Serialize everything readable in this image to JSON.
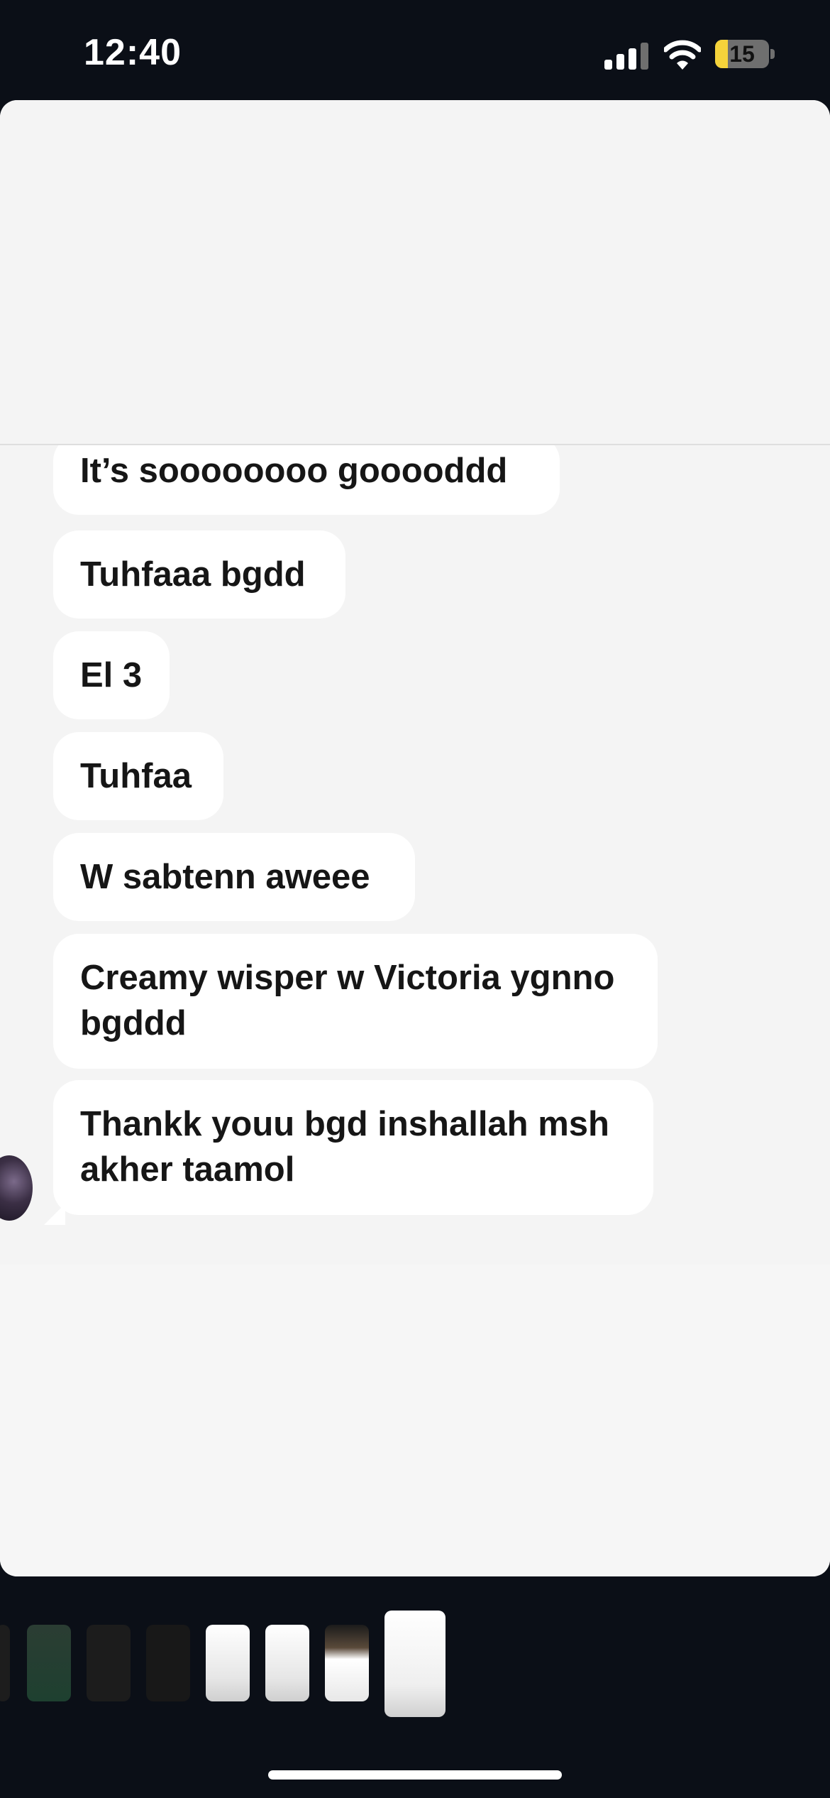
{
  "status_bar": {
    "time": "12:40",
    "battery_level": "15",
    "battery_color": "#f5d33b",
    "signal_bars_active": 3,
    "signal_bars_total": 4,
    "icons": [
      "cellular-signal-icon",
      "wifi-icon",
      "battery-icon"
    ]
  },
  "chat": {
    "messages": [
      {
        "text": "It’s soooooooo gooooddd"
      },
      {
        "text": "Tuhfaaa bgdd"
      },
      {
        "text": "El 3"
      },
      {
        "text": "Tuhfaa"
      },
      {
        "text": "W sabtenn aweee"
      },
      {
        "text": "Creamy wisper w Victoria ygnno bgddd"
      },
      {
        "text": "Thankk youu bgd inshallah msh akher taamol"
      }
    ]
  },
  "app_switcher": {
    "thumbnail_count": 8
  }
}
